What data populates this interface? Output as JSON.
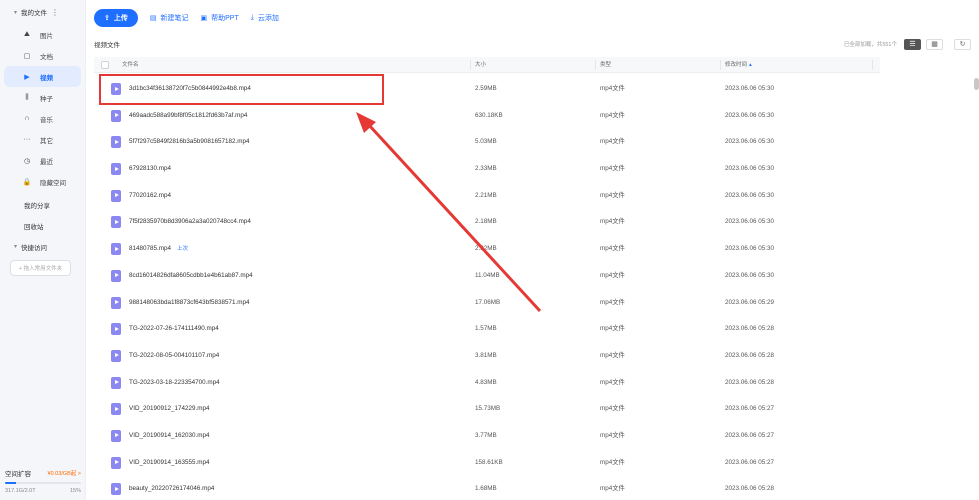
{
  "sidebar": {
    "header_label": "我的文件",
    "items": [
      {
        "icon": "image-icon",
        "glyph": "⛰",
        "label": "图片"
      },
      {
        "icon": "document-icon",
        "glyph": "▢",
        "label": "文档"
      },
      {
        "icon": "video-icon",
        "glyph": "▶",
        "label": "视频",
        "active": true
      },
      {
        "icon": "torrent-icon",
        "glyph": "⫼",
        "label": "种子"
      },
      {
        "icon": "headphones-icon",
        "glyph": "∩",
        "label": "音乐"
      },
      {
        "icon": "more-icon",
        "glyph": "···",
        "label": "其它"
      },
      {
        "icon": "clock-icon",
        "glyph": "◷",
        "label": "最近"
      },
      {
        "icon": "lock-icon",
        "glyph": "🔒",
        "label": "隐藏空间"
      }
    ],
    "my_share": "我的分享",
    "recycle_bin": "回收站",
    "quick_access": "快捷访问",
    "add_folder": "+ 拖入常用文件夹",
    "storage": {
      "title": "空间扩容",
      "promo": "¥0.03/GB起 >",
      "used": "317.1G/2.0T",
      "percent_label": "15%",
      "fraction": 0.15
    }
  },
  "toolbar": {
    "upload": "上传",
    "new_note": "新建笔记",
    "help_ppt": "帮助PPT",
    "cloud_add": "云添加"
  },
  "breadcrumb": "视频文件",
  "loaded_text": "已全部加载，共551个",
  "columns": {
    "name": "文件名",
    "size": "大小",
    "type": "类型",
    "modified": "修改时间"
  },
  "files": [
    {
      "name": "3d1bc34f36138720f7c5b0844992e4b8.mp4",
      "size": "2.59MB",
      "type": "mp4文件",
      "date": "2023.06.06 05:30"
    },
    {
      "name": "469aadc588a99bf8f05c1812fd63b7af.mp4",
      "size": "630.18KB",
      "type": "mp4文件",
      "date": "2023.06.06 05:30"
    },
    {
      "name": "5f7f297c5849f2816b3a5b9081657182.mp4",
      "size": "5.03MB",
      "type": "mp4文件",
      "date": "2023.06.06 05:30"
    },
    {
      "name": "67928130.mp4",
      "size": "2.33MB",
      "type": "mp4文件",
      "date": "2023.06.06 05:30"
    },
    {
      "name": "77020162.mp4",
      "size": "2.21MB",
      "type": "mp4文件",
      "date": "2023.06.06 05:30"
    },
    {
      "name": "7f5f2835970b8d3906a2a3a020748cc4.mp4",
      "size": "2.18MB",
      "type": "mp4文件",
      "date": "2023.06.06 05:30"
    },
    {
      "name": "81480785.mp4",
      "tag": "上次",
      "size": "2.32MB",
      "type": "mp4文件",
      "date": "2023.06.06 05:30"
    },
    {
      "name": "8cd16014826dfa8605cdbb1e4b61ab87.mp4",
      "size": "11.04MB",
      "type": "mp4文件",
      "date": "2023.06.06 05:30"
    },
    {
      "name": "988148063bda1f8873cf643bf5838571.mp4",
      "size": "17.06MB",
      "type": "mp4文件",
      "date": "2023.06.06 05:29"
    },
    {
      "name": "TG-2022-07-26-174111490.mp4",
      "size": "1.57MB",
      "type": "mp4文件",
      "date": "2023.06.06 05:28"
    },
    {
      "name": "TG-2022-08-05-004101107.mp4",
      "size": "3.81MB",
      "type": "mp4文件",
      "date": "2023.06.06 05:28"
    },
    {
      "name": "TG-2023-03-18-223354700.mp4",
      "size": "4.83MB",
      "type": "mp4文件",
      "date": "2023.06.06 05:28"
    },
    {
      "name": "VID_20190912_174229.mp4",
      "size": "15.73MB",
      "type": "mp4文件",
      "date": "2023.06.06 05:27"
    },
    {
      "name": "VID_20190914_162030.mp4",
      "size": "3.77MB",
      "type": "mp4文件",
      "date": "2023.06.06 05:27"
    },
    {
      "name": "VID_20190914_163555.mp4",
      "size": "158.61KB",
      "type": "mp4文件",
      "date": "2023.06.06 05:27"
    },
    {
      "name": "beauty_20220726174046.mp4",
      "size": "1.68MB",
      "type": "mp4文件",
      "date": "2023.06.06 05:28"
    }
  ],
  "colors": {
    "accent": "#1e6fff",
    "annotation": "#e53935",
    "file_icon": "#8b88f2"
  }
}
